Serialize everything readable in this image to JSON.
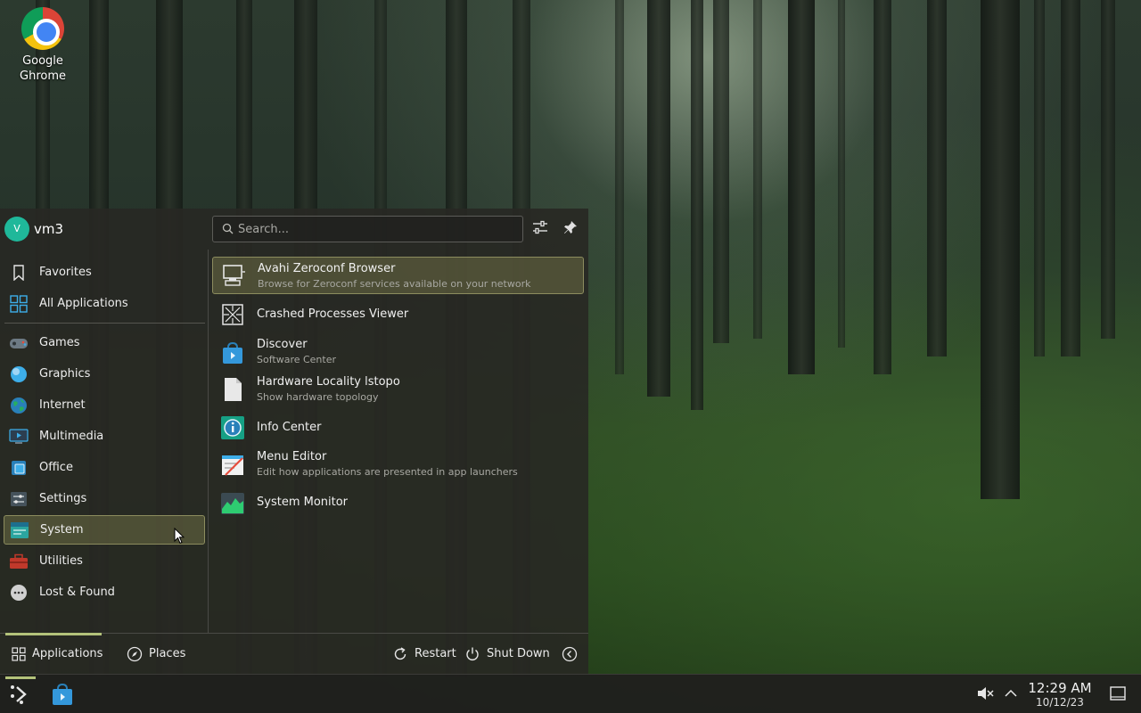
{
  "desktop": {
    "icons": [
      {
        "label": "Google\nGhrome",
        "icon": "chrome-icon"
      }
    ]
  },
  "launcher": {
    "user": {
      "avatar_letter": "V",
      "name": "vm3"
    },
    "search": {
      "placeholder": "Search...",
      "value": ""
    },
    "header_buttons": [
      {
        "name": "configure",
        "icon": "sliders-icon"
      },
      {
        "name": "pin",
        "icon": "pin-icon"
      }
    ],
    "categories_top": [
      {
        "label": "Favorites",
        "icon": "bookmark-icon"
      },
      {
        "label": "All Applications",
        "icon": "grid-icon"
      }
    ],
    "categories": [
      {
        "label": "Games",
        "icon": "gamepad-icon"
      },
      {
        "label": "Graphics",
        "icon": "graphics-icon"
      },
      {
        "label": "Internet",
        "icon": "globe-icon"
      },
      {
        "label": "Multimedia",
        "icon": "multimedia-icon"
      },
      {
        "label": "Office",
        "icon": "office-icon"
      },
      {
        "label": "Settings",
        "icon": "settings-icon"
      },
      {
        "label": "System",
        "icon": "system-icon",
        "selected": true
      },
      {
        "label": "Utilities",
        "icon": "toolbox-icon"
      },
      {
        "label": "Lost & Found",
        "icon": "ellipsis-icon"
      }
    ],
    "apps": [
      {
        "name": "Avahi Zeroconf Browser",
        "description": "Browse for Zeroconf services available on your network",
        "icon": "network-computer-icon",
        "selected": true
      },
      {
        "name": "Crashed Processes Viewer",
        "description": "",
        "icon": "crash-icon"
      },
      {
        "name": "Discover",
        "description": "Software Center",
        "icon": "discover-icon"
      },
      {
        "name": "Hardware Locality lstopo",
        "description": "Show hardware topology",
        "icon": "document-icon"
      },
      {
        "name": "Info Center",
        "description": "",
        "icon": "info-icon"
      },
      {
        "name": "Menu Editor",
        "description": "Edit how applications are presented in app launchers",
        "icon": "menu-editor-icon"
      },
      {
        "name": "System Monitor",
        "description": "",
        "icon": "system-monitor-icon"
      }
    ],
    "footer": {
      "tabs": [
        {
          "label": "Applications",
          "icon": "grid-icon",
          "active": true
        },
        {
          "label": "Places",
          "icon": "compass-icon"
        }
      ],
      "actions": [
        {
          "label": "Restart",
          "icon": "restart-icon"
        },
        {
          "label": "Shut Down",
          "icon": "power-icon"
        },
        {
          "label": "",
          "icon": "chevron-left-icon"
        }
      ]
    }
  },
  "taskbar": {
    "tray": [
      {
        "icon": "muted-speaker-icon"
      },
      {
        "icon": "chevron-up-icon"
      }
    ],
    "clock": {
      "time": "12:29 AM",
      "date": "10/12/23"
    },
    "show_desktop_icon": "show-desktop-icon"
  },
  "colors": {
    "accent": "#b3c27a",
    "selection": "#6e6e46",
    "panel": "#282824",
    "avatar": "#1fb89a"
  }
}
